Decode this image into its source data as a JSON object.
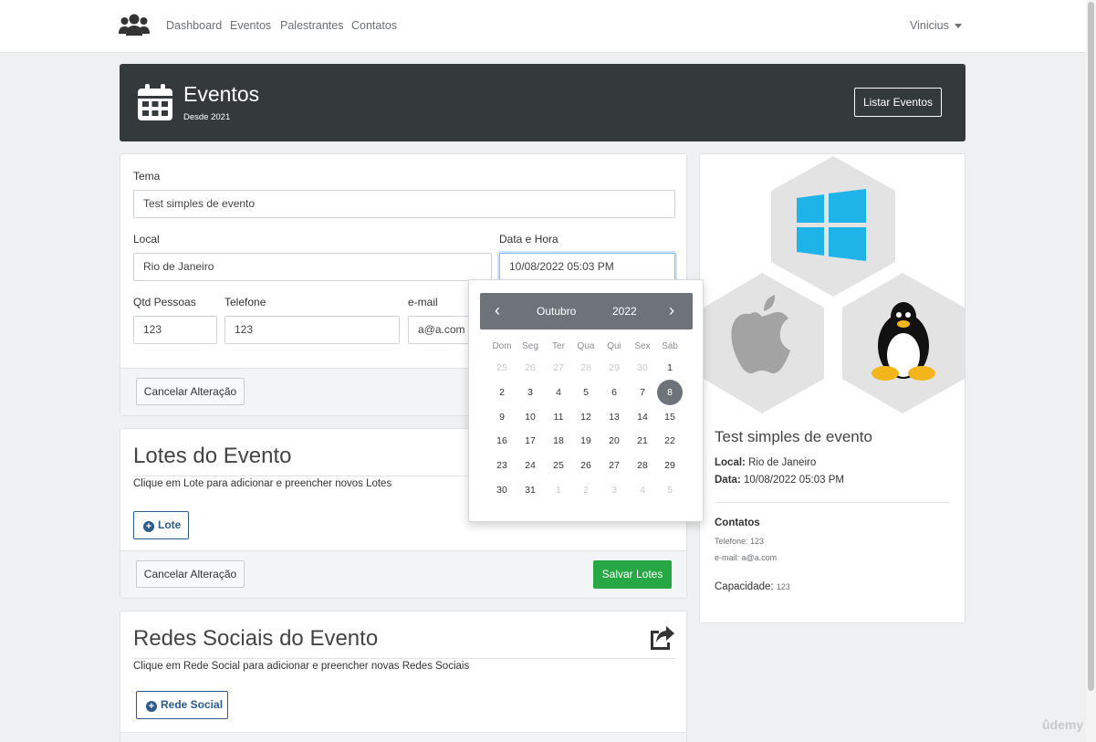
{
  "nav": {
    "links": [
      "Dashboard",
      "Eventos",
      "Palestrantes",
      "Contatos"
    ],
    "user": "Vinicius"
  },
  "banner": {
    "title": "Eventos",
    "subtitle": "Desde 2021",
    "button": "Listar Eventos"
  },
  "form": {
    "tema_label": "Tema",
    "tema_value": "Test simples de evento",
    "local_label": "Local",
    "local_value": "Rio de Janeiro",
    "data_label": "Data e Hora",
    "data_value": "10/08/2022 05:03 PM",
    "qtd_label": "Qtd Pessoas",
    "qtd_value": "123",
    "telefone_label": "Telefone",
    "telefone_value": "123",
    "email_label": "e-mail",
    "email_value": "a@a.com",
    "cancel_button": "Cancelar Alteração"
  },
  "lotes": {
    "title": "Lotes do Evento",
    "description": "Clique em Lote para adicionar e preencher novos Lotes",
    "add_button": "Lote",
    "cancel_button": "Cancelar Alteração",
    "save_button": "Salvar Lotes"
  },
  "redes": {
    "title": "Redes Sociais do Evento",
    "description": "Clique em Rede Social para adicionar e preencher novas Redes Sociais",
    "add_button": "Rede Social"
  },
  "datepicker": {
    "prev": "‹",
    "next": "›",
    "month": "Outubro",
    "year": "2022",
    "weekdays": [
      "Dom",
      "Seg",
      "Ter",
      "Qua",
      "Qui",
      "Sex",
      "Sáb"
    ],
    "weeks": [
      [
        {
          "d": "25",
          "m": true
        },
        {
          "d": "26",
          "m": true
        },
        {
          "d": "27",
          "m": true
        },
        {
          "d": "28",
          "m": true
        },
        {
          "d": "29",
          "m": true
        },
        {
          "d": "30",
          "m": true
        },
        {
          "d": "1"
        }
      ],
      [
        {
          "d": "2"
        },
        {
          "d": "3"
        },
        {
          "d": "4"
        },
        {
          "d": "5"
        },
        {
          "d": "6"
        },
        {
          "d": "7"
        },
        {
          "d": "8",
          "a": true
        }
      ],
      [
        {
          "d": "9"
        },
        {
          "d": "10"
        },
        {
          "d": "11"
        },
        {
          "d": "12"
        },
        {
          "d": "13"
        },
        {
          "d": "14"
        },
        {
          "d": "15"
        }
      ],
      [
        {
          "d": "16"
        },
        {
          "d": "17"
        },
        {
          "d": "18"
        },
        {
          "d": "19"
        },
        {
          "d": "20"
        },
        {
          "d": "21"
        },
        {
          "d": "22"
        }
      ],
      [
        {
          "d": "23"
        },
        {
          "d": "24"
        },
        {
          "d": "25"
        },
        {
          "d": "26"
        },
        {
          "d": "27"
        },
        {
          "d": "28"
        },
        {
          "d": "29"
        }
      ],
      [
        {
          "d": "30"
        },
        {
          "d": "31"
        },
        {
          "d": "1",
          "m": true
        },
        {
          "d": "2",
          "m": true
        },
        {
          "d": "3",
          "m": true
        },
        {
          "d": "4",
          "m": true
        },
        {
          "d": "5",
          "m": true
        }
      ]
    ]
  },
  "preview": {
    "title": "Test simples de evento",
    "local_label": "Local:",
    "local_value": "Rio de Janeiro",
    "data_label": "Data:",
    "data_value": "10/08/2022 05:03 PM",
    "contatos_label": "Contatos",
    "telefone": "Telefone: 123",
    "email": "e-mail: a@a.com",
    "capacidade_label": "Capacidade:",
    "capacidade_value": "123"
  },
  "watermark": "ûdemy",
  "colors": {
    "banner": "#343a3c",
    "primary": "#2c5b8c",
    "success": "#28a745",
    "windows": "#1eb4e8"
  }
}
